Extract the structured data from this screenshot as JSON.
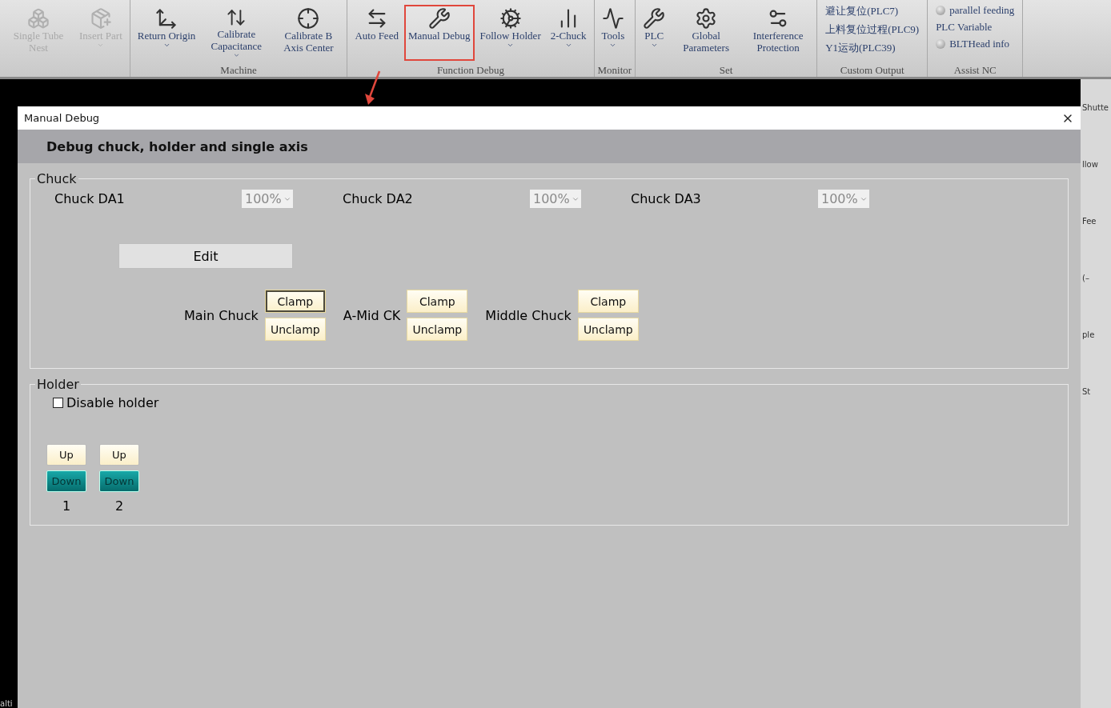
{
  "ribbon": {
    "groups": [
      {
        "items": [
          {
            "kind": "button",
            "label": "Single Tube Nest",
            "disabled": true,
            "dropdown": false,
            "selected": false
          },
          {
            "kind": "button",
            "label": "Insert Part",
            "disabled": true,
            "dropdown": true,
            "selected": false
          }
        ]
      },
      {
        "label": "Machine",
        "items": [
          {
            "kind": "button",
            "label": "Return Origin",
            "disabled": false,
            "dropdown": true,
            "selected": false
          },
          {
            "kind": "button",
            "label": "Calibrate Capacitance",
            "disabled": false,
            "dropdown": true,
            "selected": false
          },
          {
            "kind": "button",
            "label": "Calibrate B Axis Center",
            "disabled": false,
            "dropdown": false,
            "selected": false
          }
        ]
      },
      {
        "label": "Function Debug",
        "items": [
          {
            "kind": "button",
            "label": "Auto Feed",
            "disabled": false,
            "dropdown": false,
            "selected": false
          },
          {
            "kind": "button",
            "label": "Manual Debug",
            "disabled": false,
            "dropdown": false,
            "selected": true
          },
          {
            "kind": "button",
            "label": "Follow Holder",
            "disabled": false,
            "dropdown": true,
            "selected": false
          },
          {
            "kind": "button",
            "label": "2-Chuck",
            "disabled": false,
            "dropdown": true,
            "selected": false
          }
        ]
      },
      {
        "label": "Monitor",
        "items": [
          {
            "kind": "button",
            "label": "Tools",
            "disabled": false,
            "dropdown": true,
            "selected": false
          }
        ]
      },
      {
        "label": "Set",
        "items": [
          {
            "kind": "button",
            "label": "PLC",
            "disabled": false,
            "dropdown": true,
            "selected": false
          },
          {
            "kind": "button",
            "label": "Global Parameters",
            "disabled": false,
            "dropdown": false,
            "selected": false
          },
          {
            "kind": "button",
            "label": "Interference Protection",
            "disabled": false,
            "dropdown": false,
            "selected": false
          }
        ]
      },
      {
        "label": "Custom Output",
        "items": [
          {
            "kind": "text",
            "label": "避让复位(PLC7)"
          },
          {
            "kind": "text",
            "label": "上料复位过程(PLC9)"
          },
          {
            "kind": "text",
            "label": "Y1运动(PLC39)"
          }
        ]
      },
      {
        "label": "Assist NC",
        "items": [
          {
            "kind": "led",
            "label": "parallel feeding"
          },
          {
            "kind": "text",
            "label": "PLC Variable"
          },
          {
            "kind": "led",
            "label": "BLTHead info"
          }
        ]
      }
    ]
  },
  "background_fragments": {
    "right": [
      "Shutte",
      "llow",
      "Fee",
      "(–",
      "ple",
      "St"
    ],
    "bottom_left": "alti"
  },
  "dialog": {
    "title": "Manual Debug",
    "header": "Debug chuck, holder and single axis",
    "chuck": {
      "legend": "Chuck",
      "da": [
        {
          "label": "Chuck DA1",
          "value": "100%"
        },
        {
          "label": "Chuck DA2",
          "value": "100%"
        },
        {
          "label": "Chuck DA3",
          "value": "100%"
        }
      ],
      "edit_button": "Edit",
      "chucks": [
        {
          "name": "Main Chuck",
          "clamp": "Clamp",
          "unclamp": "Unclamp",
          "focused": true
        },
        {
          "name": "A-Mid CK",
          "clamp": "Clamp",
          "unclamp": "Unclamp",
          "focused": false
        },
        {
          "name": "Middle Chuck",
          "clamp": "Clamp",
          "unclamp": "Unclamp",
          "focused": false
        }
      ]
    },
    "holder": {
      "legend": "Holder",
      "disable_holder": {
        "label": "Disable holder",
        "checked": false
      },
      "units": [
        {
          "up": "Up",
          "down": "Down",
          "down_active": true,
          "number": "1"
        },
        {
          "up": "Up",
          "down": "Down",
          "down_active": true,
          "number": "2"
        }
      ]
    }
  }
}
